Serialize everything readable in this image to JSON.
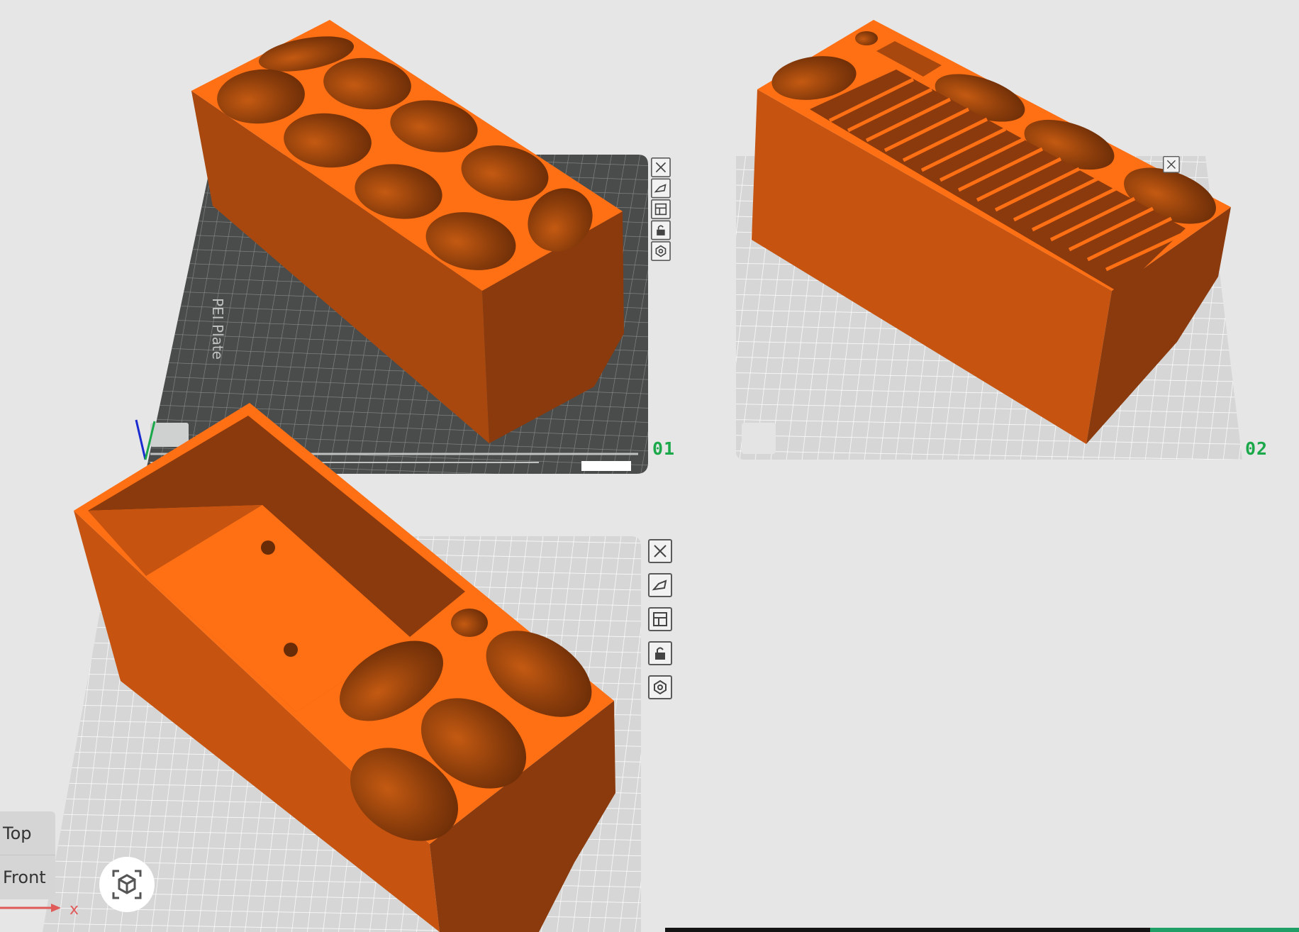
{
  "plates": [
    {
      "number": "01"
    },
    {
      "number": "02"
    }
  ],
  "plate_texture_label": "PEI Plate",
  "plate_toolbar_icons": [
    "close-icon",
    "auto-orient-icon",
    "arrange-icon",
    "lock-icon",
    "settings-icon"
  ],
  "view_menu": {
    "top": "Top",
    "front": "Front"
  },
  "axis": {
    "x": "x"
  },
  "colors": {
    "background": "#e6e6e6",
    "model_top": "#ff6f14",
    "model_side": "#c65410",
    "model_dark": "#8a3a0c",
    "active_plate": "#4a4c4c",
    "plate_number": "#1aa84a"
  }
}
